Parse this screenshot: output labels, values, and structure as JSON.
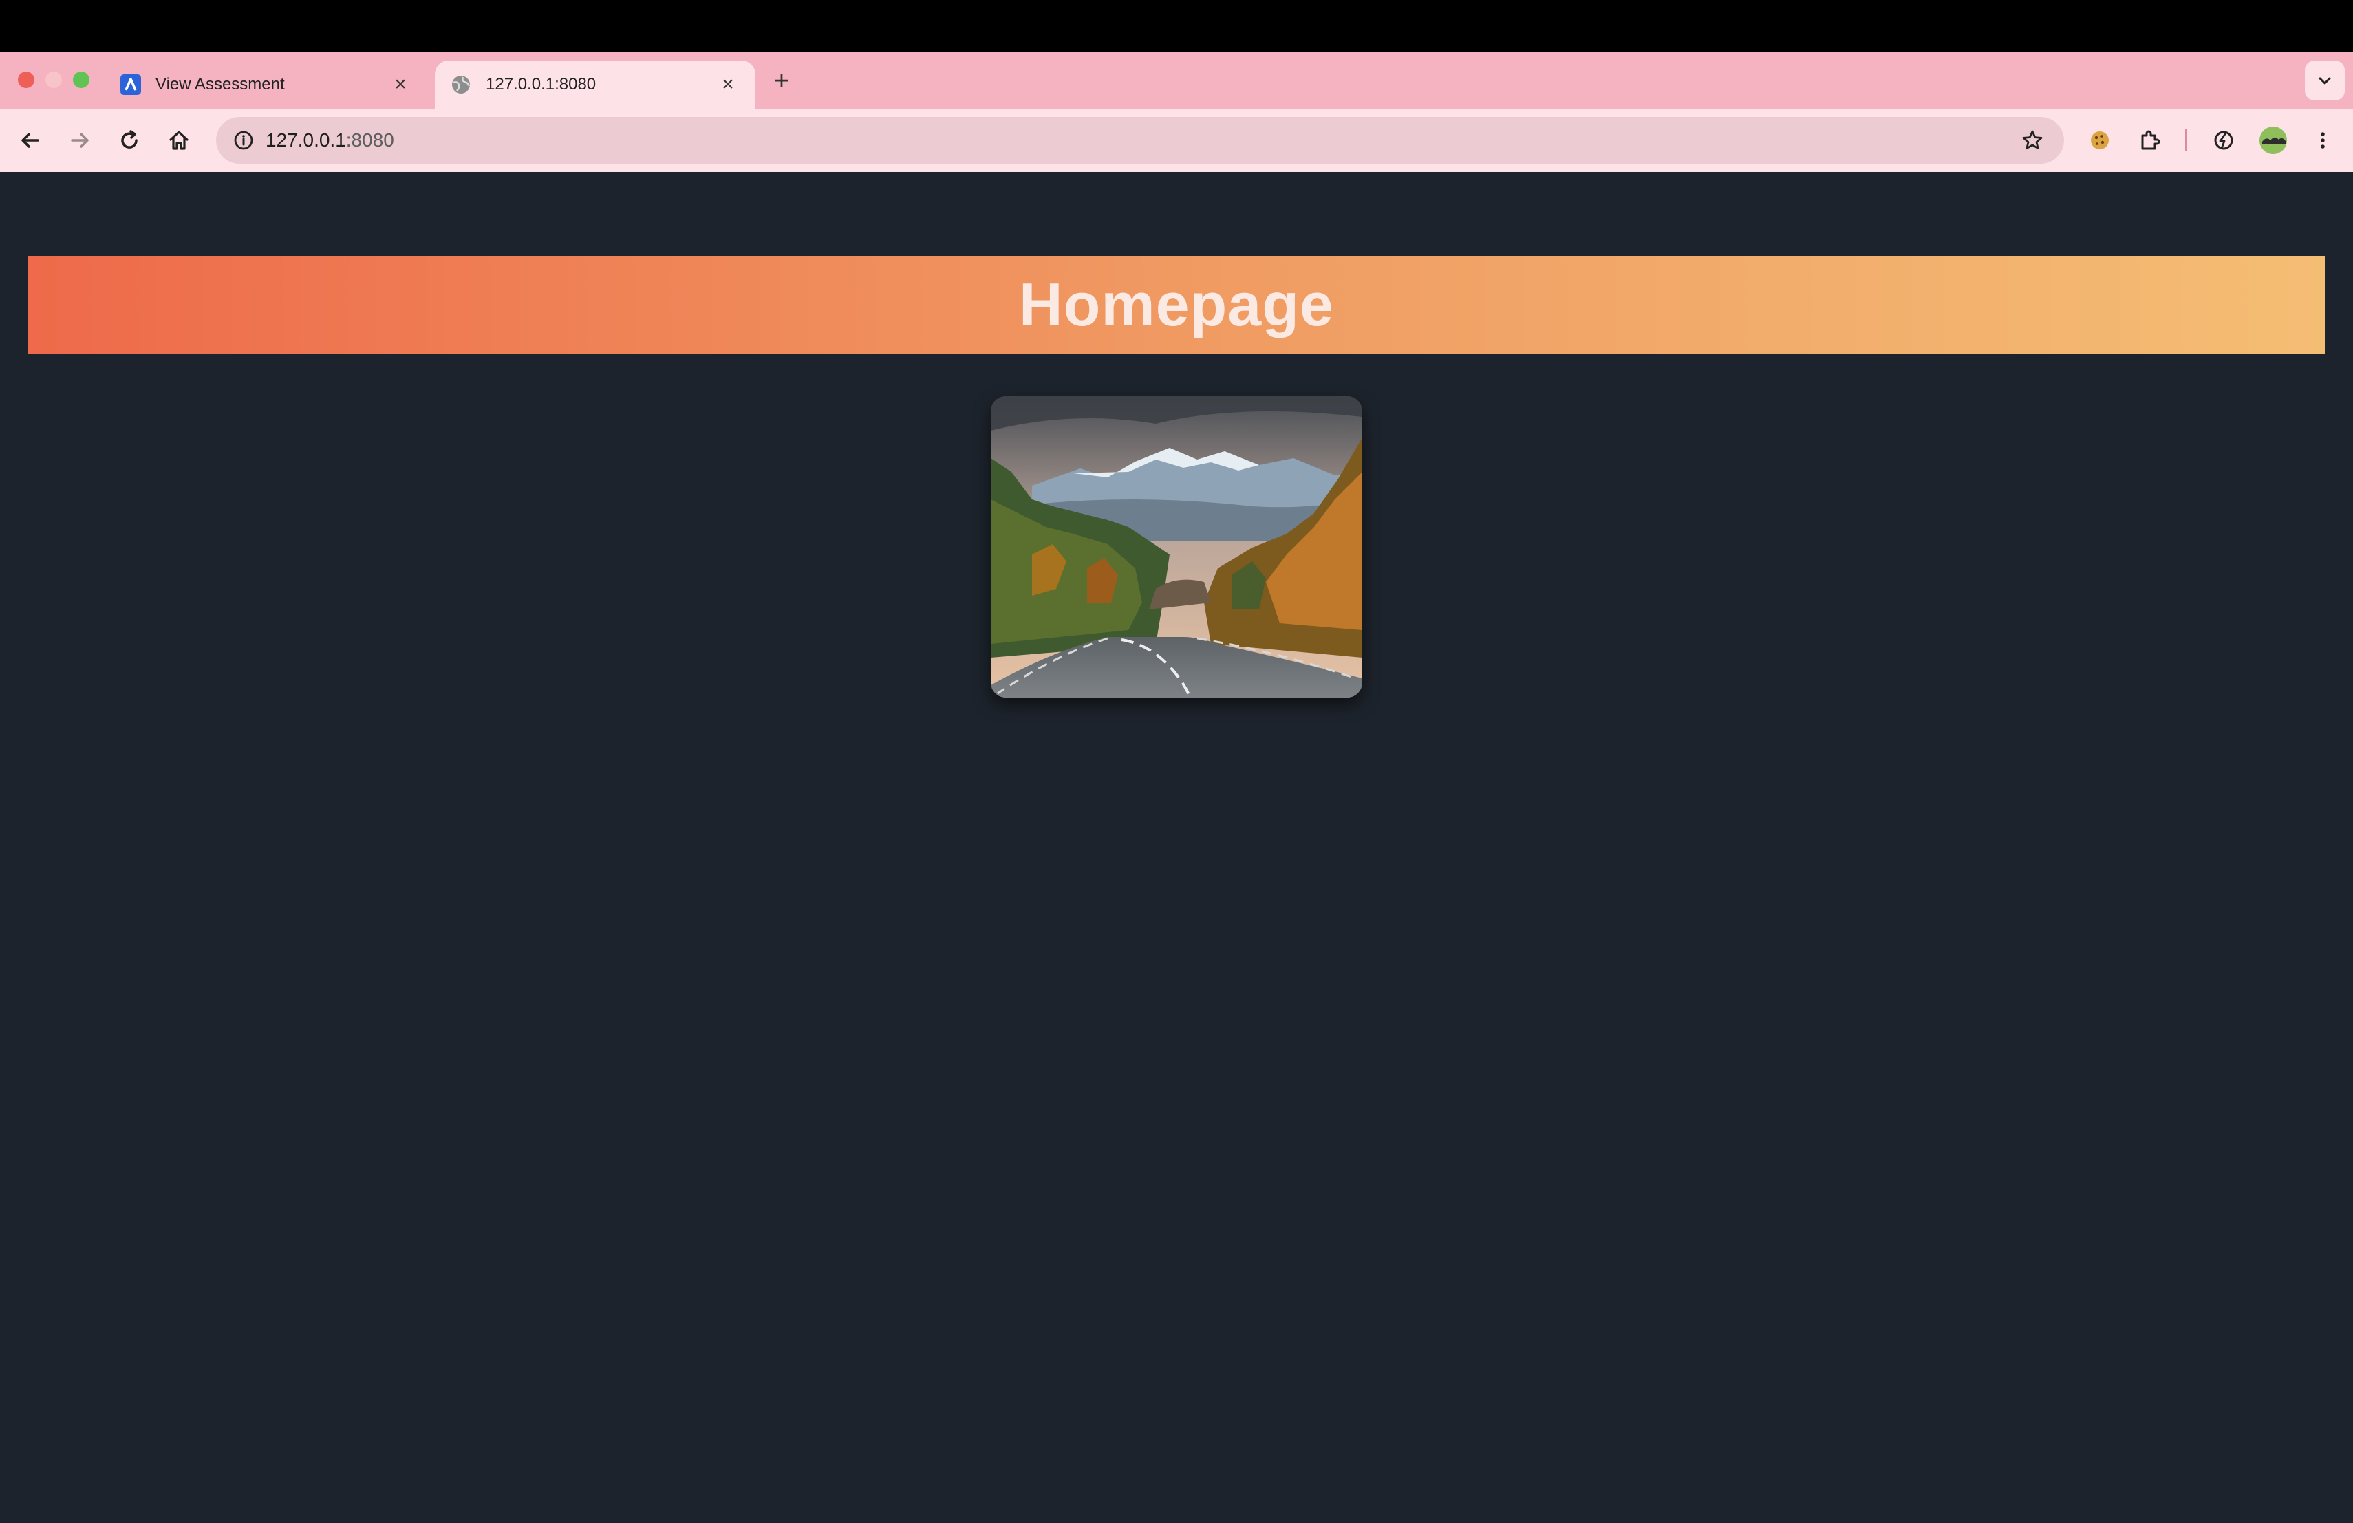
{
  "browser": {
    "tabs": [
      {
        "title": "View Assessment",
        "favicon": "blue-a-favicon",
        "active": false
      },
      {
        "title": "127.0.0.1:8080",
        "favicon": "globe-icon",
        "active": true
      }
    ],
    "address": {
      "host": "127.0.0.1",
      "port": ":8080"
    },
    "colors": {
      "tabstrip": "#f5b3c1",
      "toolbar": "#fde2e8",
      "close_light": "#ee5f57",
      "min_light": "#f6c4c9",
      "zoom_light": "#5fc453"
    },
    "toolbar_icons": [
      "back-arrow-icon",
      "forward-arrow-icon",
      "reload-icon",
      "home-icon",
      "site-info-icon",
      "bookmark-star-icon",
      "cookie-extension-icon",
      "extensions-puzzle-icon",
      "performance-icon",
      "profile-avatar",
      "more-menu-icon"
    ]
  },
  "page": {
    "title": "Homepage",
    "background": "#1d232c",
    "header_gradient": [
      "#ee6a4a",
      "#f4bd74"
    ],
    "image": {
      "subject": "mountain road through autumn forest"
    }
  }
}
